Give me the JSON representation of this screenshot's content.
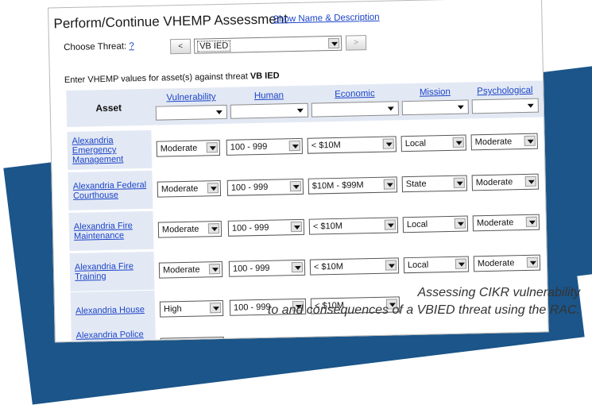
{
  "header": {
    "title": "Perform/Continue VHEMP Assessment",
    "show_link": "Show Name & Description"
  },
  "threat": {
    "label": "Choose Threat:",
    "help": "?",
    "prev": "<",
    "next": ">",
    "selected": "VB IED"
  },
  "intro": {
    "prefix": "Enter VHEMP values for asset(s) against threat",
    "threat": "VB IED"
  },
  "table": {
    "asset_header": "Asset",
    "columns": [
      "Vulnerability",
      "Human",
      "Economic",
      "Mission",
      "Psychological"
    ],
    "rows": [
      {
        "asset": "Alexandria Emergency Management",
        "values": [
          "Moderate",
          "100 - 999",
          "< $10M",
          "Local",
          "Moderate"
        ]
      },
      {
        "asset": "Alexandria Federal Courthouse",
        "values": [
          "Moderate",
          "100 - 999",
          "$10M - $99M",
          "State",
          "Moderate"
        ]
      },
      {
        "asset": "Alexandria Fire Maintenance",
        "values": [
          "Moderate",
          "100 - 999",
          "< $10M",
          "Local",
          "Moderate"
        ]
      },
      {
        "asset": "Alexandria Fire Training",
        "values": [
          "Moderate",
          "100 - 999",
          "< $10M",
          "Local",
          "Moderate"
        ]
      },
      {
        "asset": "Alexandria House",
        "values": [
          "High",
          "100 - 999",
          "< $10M",
          "",
          ""
        ]
      },
      {
        "asset": "Alexandria Police Department",
        "values": [
          "",
          "",
          "",
          "",
          ""
        ]
      }
    ]
  },
  "caption": {
    "line1": "Assessing CIKR vulnerability",
    "line2": "to and consequences of a VBIED threat using the RAC."
  },
  "colors": {
    "band": "#1b5589",
    "link": "#1c44c8",
    "header_bg": "#e3e9f4"
  }
}
